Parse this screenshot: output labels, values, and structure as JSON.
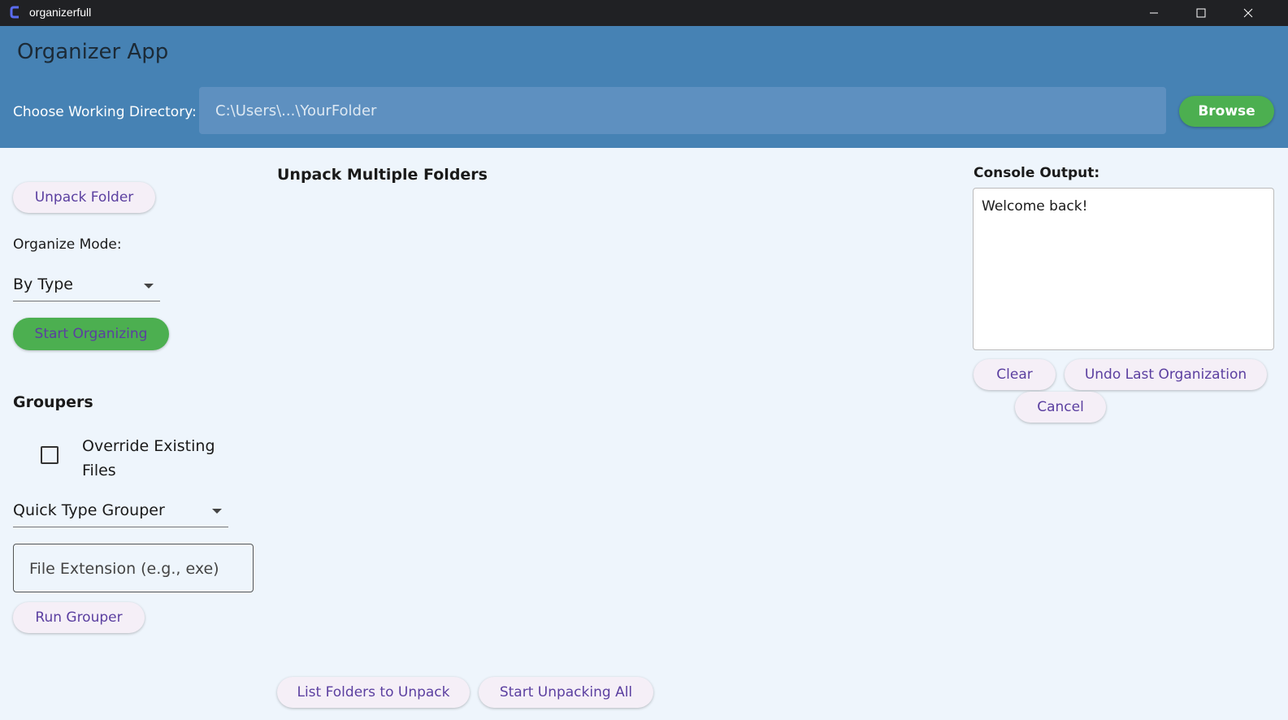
{
  "window": {
    "title": "organizerfull",
    "icons": {
      "minimize": "minimize-icon",
      "maximize": "maximize-icon",
      "close": "close-icon"
    }
  },
  "header": {
    "app_title": "Organizer App",
    "directory_label": "Choose Working Directory:",
    "directory_placeholder": "C:\\Users\\...\\YourFolder",
    "browse_label": "Browse"
  },
  "left_panel": {
    "unpack_folder_label": "Unpack Folder",
    "organize_mode_label": "Organize Mode:",
    "organize_mode_value": "By Type",
    "start_organizing_label": "Start Organizing",
    "groupers_heading": "Groupers",
    "override_label_line1": "Override Existing",
    "override_label_line2": "Files",
    "override_checked": false,
    "grouper_value": "Quick Type Grouper",
    "extension_placeholder": "File Extension (e.g., exe)",
    "run_grouper_label": "Run Grouper"
  },
  "middle_panel": {
    "heading": "Unpack Multiple Folders",
    "list_folders_label": "List Folders to Unpack",
    "start_unpacking_label": "Start Unpacking All"
  },
  "console": {
    "label": "Console Output:",
    "text": "Welcome back!",
    "clear_label": "Clear",
    "undo_label": "Undo Last Organization",
    "cancel_label": "Cancel"
  },
  "colors": {
    "header_bg": "#4682b4",
    "accent_green": "#4caf50",
    "button_text": "#5b3fa0",
    "page_bg": "#eef5fc"
  }
}
